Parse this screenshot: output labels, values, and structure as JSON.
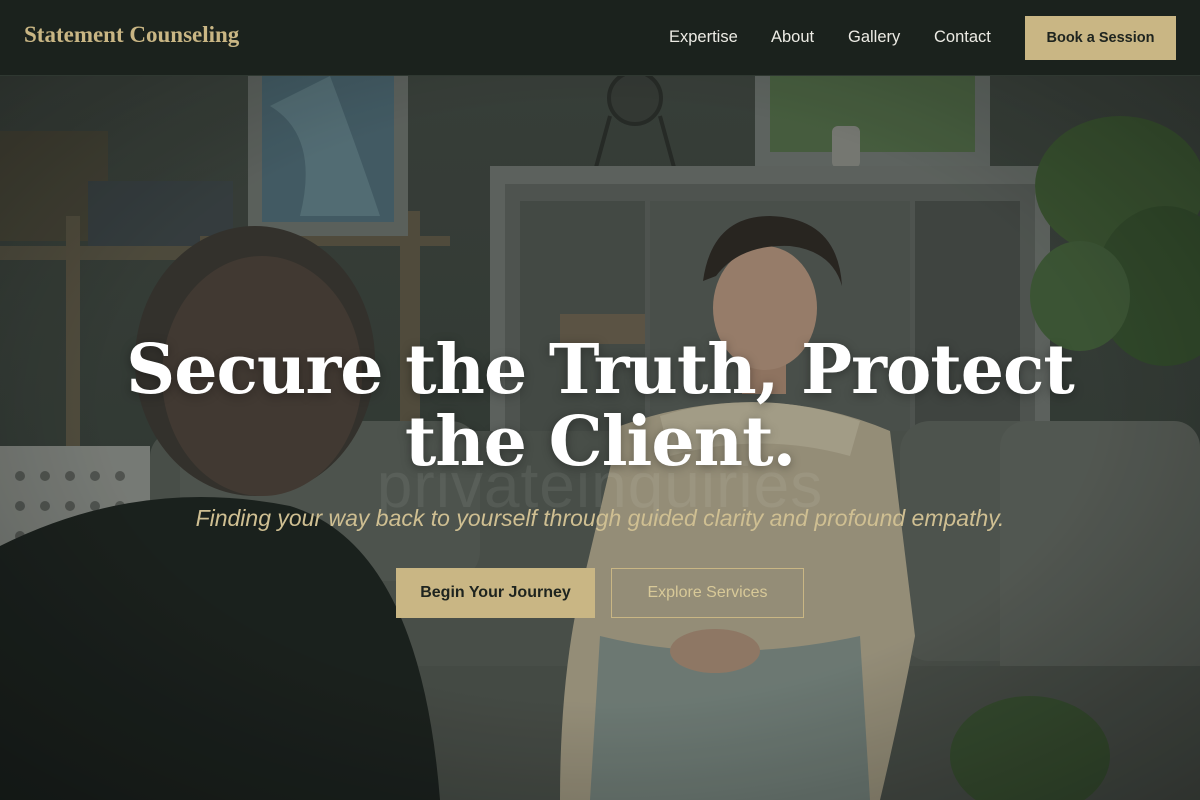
{
  "header": {
    "brand": "Statement Counseling",
    "nav": [
      {
        "label": "Expertise"
      },
      {
        "label": "About"
      },
      {
        "label": "Gallery"
      },
      {
        "label": "Contact"
      }
    ],
    "cta_label": "Book a Session"
  },
  "hero": {
    "title_line1": "Secure the Truth, Protect",
    "title_line2": "the Client.",
    "subtitle": "Finding your way back to yourself through guided clarity and profound empathy.",
    "watermark": "privateinquiries",
    "primary_button": "Begin Your Journey",
    "secondary_button": "Explore Services"
  },
  "colors": {
    "header_bg": "#1b221d",
    "accent_gold": "#c9b684",
    "title_text": "#ffffff",
    "subtitle_text": "#cfbf92"
  }
}
